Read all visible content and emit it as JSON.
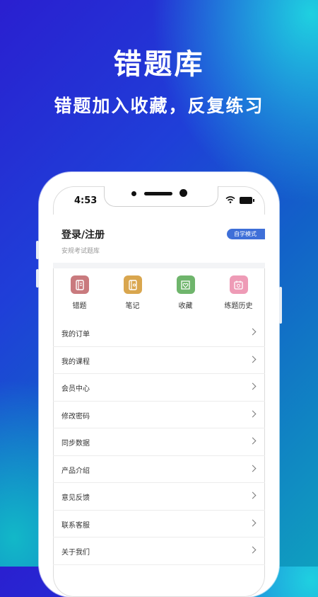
{
  "hero": {
    "title": "错题库",
    "subtitle": "错题加入收藏，反复练习"
  },
  "status_bar": {
    "time": "4:53"
  },
  "profile": {
    "login_label": "登录/注册",
    "subtitle": "安规考试题库",
    "mode_badge": "自学模式"
  },
  "shortcuts": [
    {
      "label": "错题",
      "icon": "notebook-icon",
      "color": "#c97a7e"
    },
    {
      "label": "笔记",
      "icon": "note-icon",
      "color": "#d9a64e"
    },
    {
      "label": "收藏",
      "icon": "favorite-icon",
      "color": "#6fb56c"
    },
    {
      "label": "练题历史",
      "icon": "history-calendar-icon",
      "color": "#ee9bb6"
    }
  ],
  "menu": [
    {
      "label": "我的订单"
    },
    {
      "label": "我的课程"
    },
    {
      "label": "会员中心"
    },
    {
      "label": "修改密码"
    },
    {
      "label": "同步数据"
    },
    {
      "label": "产品介绍"
    },
    {
      "label": "意见反馈"
    },
    {
      "label": "联系客服"
    },
    {
      "label": "关于我们"
    }
  ]
}
